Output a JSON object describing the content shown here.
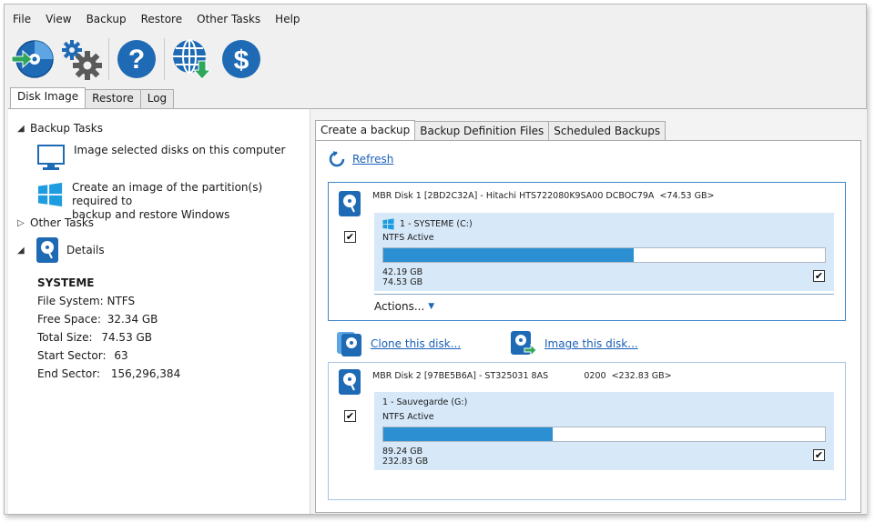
{
  "menu": [
    "File",
    "View",
    "Backup",
    "Restore",
    "Other Tasks",
    "Help"
  ],
  "toolbar": {
    "icons": [
      "backup-disc-icon",
      "settings-gears-icon",
      "help-icon",
      "web-download-icon",
      "purchase-icon"
    ],
    "help_glyph": "?",
    "dollar_glyph": "$"
  },
  "main_tabs": [
    "Disk Image",
    "Restore",
    "Log"
  ],
  "left": {
    "backup_tasks": "Backup Tasks",
    "task1": "Image selected disks on this computer",
    "task2_line1": "Create an image of the partition(s) required to",
    "task2_line2": "backup and restore Windows",
    "other_tasks": "Other Tasks",
    "details": "Details",
    "details_name": "SYSTEME",
    "fs": "File System: NTFS",
    "free_label": "Free Space:",
    "free_value": "32.34 GB",
    "total_label": "Total Size:",
    "total_value": "74.53 GB",
    "start_label": "Start Sector:",
    "start_value": "63",
    "end_label": "End Sector:",
    "end_value": "156,296,384"
  },
  "sub_tabs": [
    "Create a backup",
    "Backup Definition Files",
    "Scheduled Backups"
  ],
  "refresh": "Refresh",
  "disk1": {
    "title": "MBR Disk 1 [2BD2C32A] - Hitachi HTS722080K9SA00 DCBOC79A  <74.53 GB>",
    "part_name": "1 - SYSTEME (C:)",
    "part_fs": "NTFS Active",
    "used_fraction": 0.566,
    "used": "42.19 GB",
    "total": "74.53 GB",
    "actions": "Actions..."
  },
  "clone": "Clone this disk...",
  "image": "Image this disk...",
  "disk2": {
    "title": "MBR Disk 2 [97BE5B6A] - ST325031 8AS             0200  <232.83 GB>",
    "part_name": "1 - Sauvegarde (G:)",
    "part_fs": "NTFS Active",
    "used_fraction": 0.383,
    "used": "89.24 GB",
    "total": "232.83 GB"
  },
  "checkmark": "✔",
  "colors": {
    "accent": "#2b8fd1",
    "link": "#1b5fb8",
    "partition_bg": "#d7e8f8",
    "toolbar_blue": "#1e6ab4"
  }
}
